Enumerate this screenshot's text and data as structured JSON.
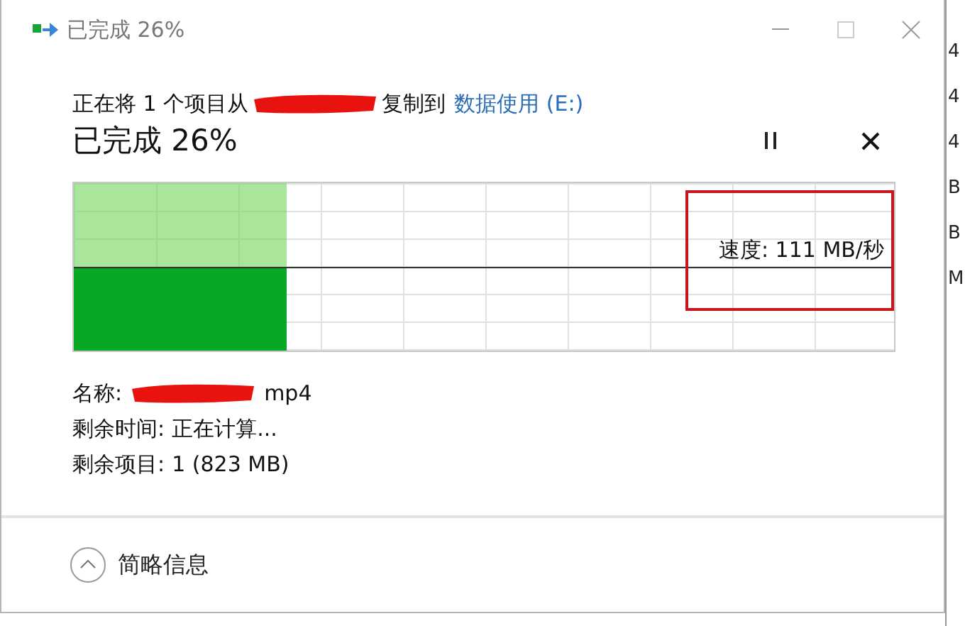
{
  "window": {
    "title": "已完成 26%"
  },
  "copy_line": {
    "prefix": "正在将 1 个项目从",
    "middle": "复制到",
    "destination": "数据使用 (E:)"
  },
  "heading": "已完成 26%",
  "progress": {
    "level": 0.26,
    "speed": "速度: 111 MB/秒"
  },
  "details": [
    {
      "label": "名称:",
      "value": "mp4",
      "redacted": true
    },
    {
      "label": "剩余时间:",
      "value": "正在计算...",
      "redacted": false
    },
    {
      "label": "剩余项目:",
      "value": "1 (823 MB)",
      "redacted": false
    }
  ],
  "footer": {
    "label": "简略信息"
  },
  "background_fragments": [
    "4",
    "4",
    "4",
    "B",
    "B",
    "M"
  ]
}
